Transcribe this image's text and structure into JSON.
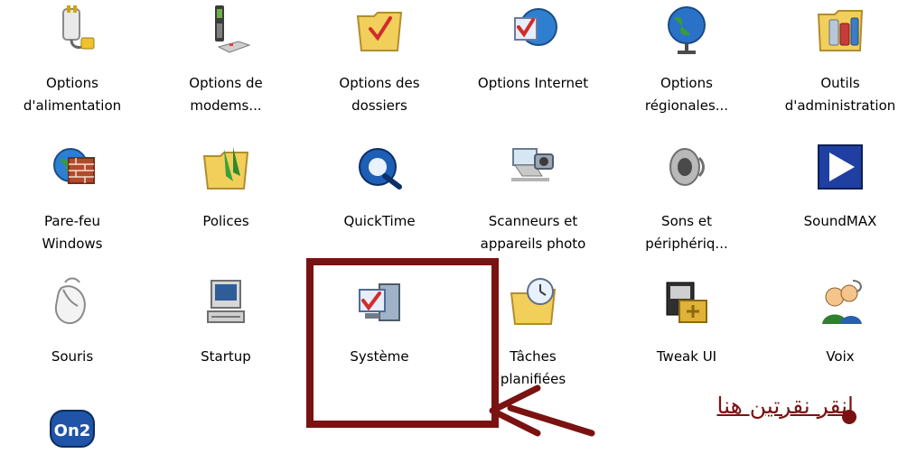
{
  "items": [
    {
      "label": "Options\nd'alimentation",
      "icon": "power-plug-icon"
    },
    {
      "label": "Options de\nmodems...",
      "icon": "modem-phone-icon"
    },
    {
      "label": "Options des\ndossiers",
      "icon": "folder-check-icon"
    },
    {
      "label": "Options Internet",
      "icon": "internet-globe-icon"
    },
    {
      "label": "Options\nrégionales...",
      "icon": "globe-icon"
    },
    {
      "label": "Outils\nd'administration",
      "icon": "admin-tools-icon"
    },
    {
      "label": "Pare-feu\nWindows",
      "icon": "firewall-icon"
    },
    {
      "label": "Polices",
      "icon": "fonts-folder-icon"
    },
    {
      "label": "QuickTime",
      "icon": "quicktime-icon"
    },
    {
      "label": "Scanneurs et\nappareils photo",
      "icon": "scanner-camera-icon"
    },
    {
      "label": "Sons et\npériphériq...",
      "icon": "speaker-icon"
    },
    {
      "label": "SoundMAX",
      "icon": "play-icon"
    },
    {
      "label": "Souris",
      "icon": "mouse-icon"
    },
    {
      "label": "Startup",
      "icon": "computer-terminal-icon"
    },
    {
      "label": "Système",
      "icon": "system-icon"
    },
    {
      "label": "Tâches\nplanifiées",
      "icon": "scheduled-tasks-icon"
    },
    {
      "label": "Tweak UI",
      "icon": "tweak-ui-icon"
    },
    {
      "label": "Voix",
      "icon": "voice-people-icon"
    },
    {
      "label": "",
      "icon": "on2-icon"
    }
  ],
  "annotation": {
    "text": "انقر نقرتين هنا",
    "color": "#7a1212"
  }
}
